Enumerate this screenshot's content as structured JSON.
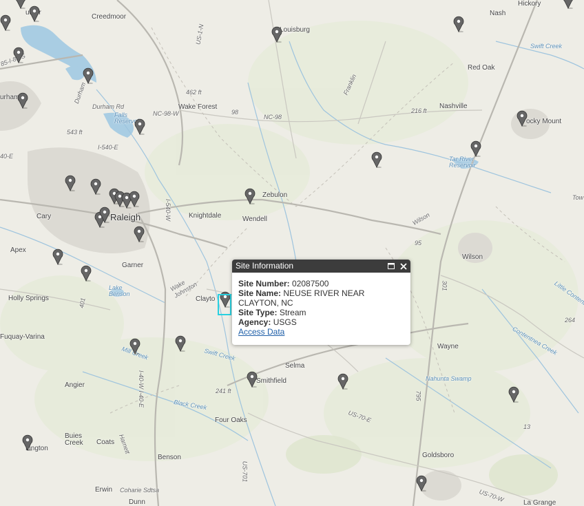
{
  "popup": {
    "title": "Site Information",
    "fields": [
      {
        "label": "Site Number:",
        "value": "02087500"
      },
      {
        "label": "Site Name:",
        "value": "NEUSE RIVER NEAR CLAYTON, NC"
      },
      {
        "label": "Site Type:",
        "value": "Stream"
      },
      {
        "label": "Agency:",
        "value": "USGS"
      }
    ],
    "link": "Access Data",
    "maximize_icon": "maximize-icon",
    "close_icon": "close-icon"
  },
  "colors": {
    "marker": "#666666",
    "highlight": "#28d0e0",
    "header": "#3c3c3c"
  },
  "places": {
    "butner": "utner",
    "creedmoor": "Creedmoor",
    "louisburg": "Louisburg",
    "hickory": "Hickory",
    "nash": "Nash",
    "red_oak": "Red Oak",
    "nashville": "Nashville",
    "rocky_mount": "ocky Mount",
    "durham": "urham",
    "durham_rd": "Durham Rd",
    "durham_label": "Durham",
    "wake_forest": "Wake Forest",
    "falls": "Falls Reservoir",
    "nc98w": "NC-98-W",
    "nc98": "NC-98",
    "nc98b": "98",
    "r543": "543 ft",
    "r462": "462 ft",
    "r216": "216 ft",
    "franklin": "Franklin",
    "swift_creek_ne": "Swift Creek",
    "tar_river": "Tar River Reservoir",
    "i540e": "I-540-E",
    "i40e": "40-E",
    "cary": "Cary",
    "raleigh": "Raleigh",
    "knightdale": "Knightdale",
    "zebulon": "Zebulon",
    "wendell": "Wendell",
    "i540w": "I-540-W",
    "wilson_rd": "Wilson",
    "wilson": "Wilson",
    "apex": "Apex",
    "garner": "Garner",
    "wake_johnston": "Wake Johnston",
    "lake_benson": "Lake Benson",
    "holly_springs": "Holly Springs",
    "clayton": "Clayto",
    "r401": "401",
    "fuquay": "Fuquay-Varina",
    "mill_creek": "Mill Creek",
    "swift_creek": "Swift Creek",
    "selma": "Selma",
    "smithfield": "Smithfield",
    "wayne": "Wayne",
    "nahunta": "Nahunta Swamp",
    "contentnea": "Contentnea Creek",
    "little_contentnea": "Little Contentnea",
    "angier": "Angier",
    "r241": "241 ft",
    "black_creek": "Black Creek",
    "four_oaks": "Four Oaks",
    "i40w": "I-40-W I-40-E",
    "buies_creek": "Buies Creek",
    "coats": "Coats",
    "harnett": "Harnett",
    "lington": "Lington",
    "benson": "Benson",
    "us701": "US-701",
    "us70e": "US-70-E",
    "us70w": "US-70-W",
    "goldsboro": "Goldsboro",
    "erwin": "Erwin",
    "cohaire": "Coharie Sdtsa",
    "dunn": "Dunn",
    "la_grange": "La Grange",
    "r264": "264",
    "r795": "795",
    "r13": "13",
    "r85": "85",
    "i85": "85-I-85-S",
    "r1": "US-1-N",
    "tow": "Tow",
    "r95": "95",
    "r301": "301",
    "r264b": "264"
  }
}
